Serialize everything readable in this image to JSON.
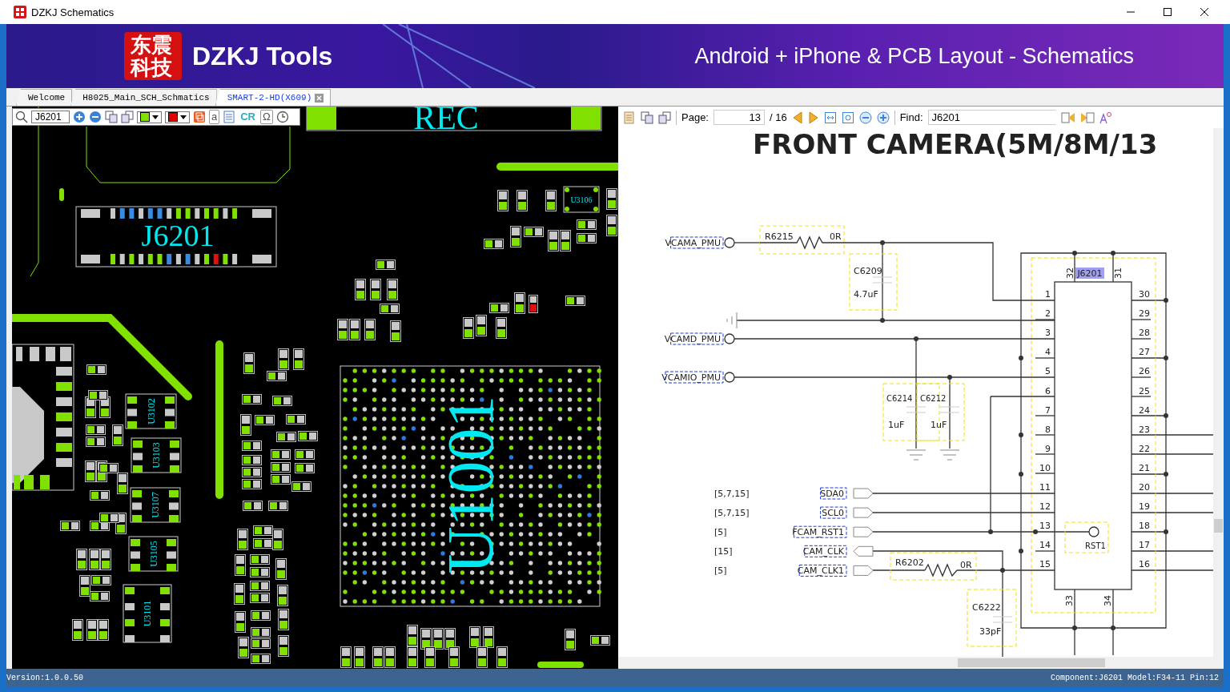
{
  "window": {
    "title": "DZKJ Schematics"
  },
  "banner": {
    "logo_text": "东震科技",
    "brand": "DZKJ Tools",
    "tagline": "Android + iPhone & PCB Layout - Schematics"
  },
  "tabs": [
    {
      "label": "Welcome",
      "selected": false
    },
    {
      "label": "H8025_Main_SCH_Schmatics",
      "selected": false
    },
    {
      "label": "SMART-2-HD(X609)",
      "selected": true
    }
  ],
  "pcb_toolbar": {
    "search": "J6201",
    "color_pickers": [
      {
        "color": "#80e000"
      },
      {
        "color": "#e00000"
      }
    ],
    "text_icons": [
      "a",
      "CR",
      "Ω"
    ]
  },
  "pcb": {
    "components": [
      "REC",
      "J6201",
      "U3106",
      "U3102",
      "U3103",
      "U3107",
      "U3105",
      "U3101",
      "U1001"
    ]
  },
  "schematic_toolbar": {
    "page_label": "Page:",
    "page": "13",
    "page_count": "/ 16",
    "find_label": "Find:",
    "find": "J6201"
  },
  "schematic": {
    "title": "FRONT CAMERA(5M/8M/13",
    "power_nets": [
      "VCAMA_PMU",
      "VCAMD_PMU",
      "VCAMIO_PMU"
    ],
    "parts": [
      {
        "ref": "R6215",
        "value": "0R"
      },
      {
        "ref": "C6209",
        "value": "4.7uF"
      },
      {
        "ref": "C6214",
        "value": "1uF"
      },
      {
        "ref": "C6212",
        "value": "1uF"
      },
      {
        "ref": "R6202",
        "value": "0R"
      },
      {
        "ref": "C6222",
        "value": "33pF"
      }
    ],
    "connector": {
      "ref": "J6201",
      "highlighted": true,
      "left_pins": [
        "1",
        "2",
        "3",
        "4",
        "5",
        "6",
        "7",
        "8",
        "9",
        "10",
        "11",
        "12",
        "13",
        "14",
        "15"
      ],
      "right_pins": [
        "30",
        "29",
        "28",
        "27",
        "26",
        "25",
        "24",
        "23",
        "22",
        "21",
        "20",
        "19",
        "18",
        "17",
        "16"
      ],
      "top_pins": [
        "32",
        "31"
      ],
      "bottom_pins": [
        "33",
        "34"
      ]
    },
    "test_point": "RST1",
    "signals": [
      {
        "ref": "[5,7,15]",
        "name": "SDA0",
        "kind": "output"
      },
      {
        "ref": "[5,7,15]",
        "name": "SCL0",
        "kind": "output"
      },
      {
        "ref": "[5]",
        "name": "FCAM_RST1",
        "kind": "output"
      },
      {
        "ref": "[15]",
        "name": "CAM_CLK",
        "kind": "input"
      },
      {
        "ref": "[5]",
        "name": "CAM_CLK1",
        "kind": "output"
      }
    ]
  },
  "status_bar": {
    "version": "Version:1.0.0.50",
    "component": "Component:J6201 Model:F34-11 Pin:12"
  }
}
